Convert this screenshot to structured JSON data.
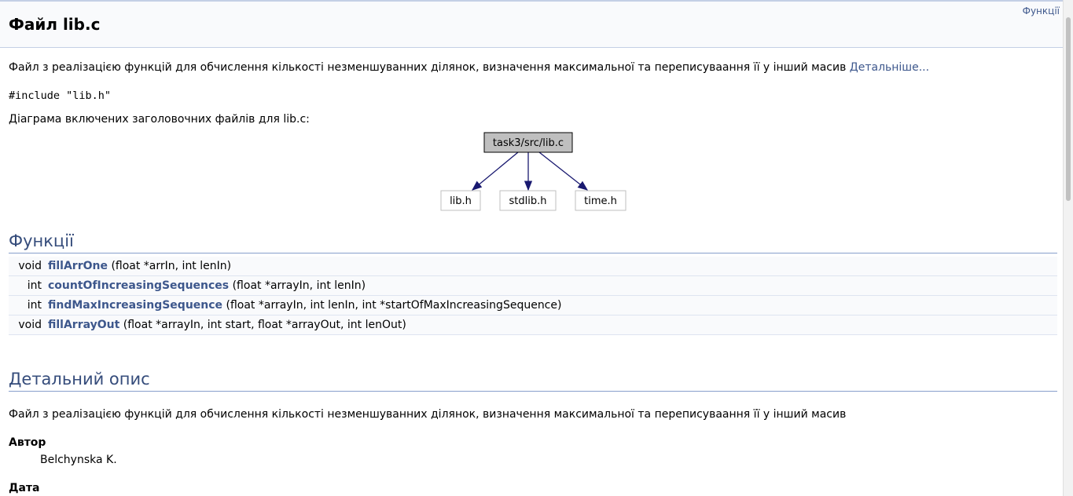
{
  "header": {
    "title": "Файл lib.c",
    "summary_link": "Функції"
  },
  "brief": {
    "text": "Файл з реалізацією функцій для обчислення кількості незменшуванних ділянок, визначення максимальної та переписуваання її у інший масив",
    "more_link": "Детальніше..."
  },
  "include": {
    "line": "#include \"lib.h\""
  },
  "graph": {
    "caption": "Діаграма включених заголовочних файлів для lib.c:",
    "root": "task3/src/lib.c",
    "children": [
      "lib.h",
      "stdlib.h",
      "time.h"
    ]
  },
  "functions": {
    "title": "Функції",
    "rows": [
      {
        "ret": "void",
        "name": "fillArrOne",
        "args": "(float *arrIn, int lenIn)"
      },
      {
        "ret": "int",
        "name": "countOfIncreasingSequences",
        "args": "(float *arrayIn, int lenIn)"
      },
      {
        "ret": "int",
        "name": "findMaxIncreasingSequence",
        "args": "(float *arrayIn, int lenIn, int *startOfMaxIncreasingSequence)"
      },
      {
        "ret": "void",
        "name": "fillArrayOut",
        "args": "(float *arrayIn, int start, float *arrayOut, int lenOut)"
      }
    ]
  },
  "details": {
    "title": "Детальний опис",
    "text": "Файл з реалізацією функцій для обчислення кількості незменшуванних ділянок, визначення максимальної та переписуваання її у інший масив",
    "author_label": "Автор",
    "author": "Belchynska K.",
    "date_label": "Дата"
  },
  "colors": {
    "accent": "#3d578c",
    "node_root_fill": "#bfbfbf",
    "edge": "#191970"
  }
}
